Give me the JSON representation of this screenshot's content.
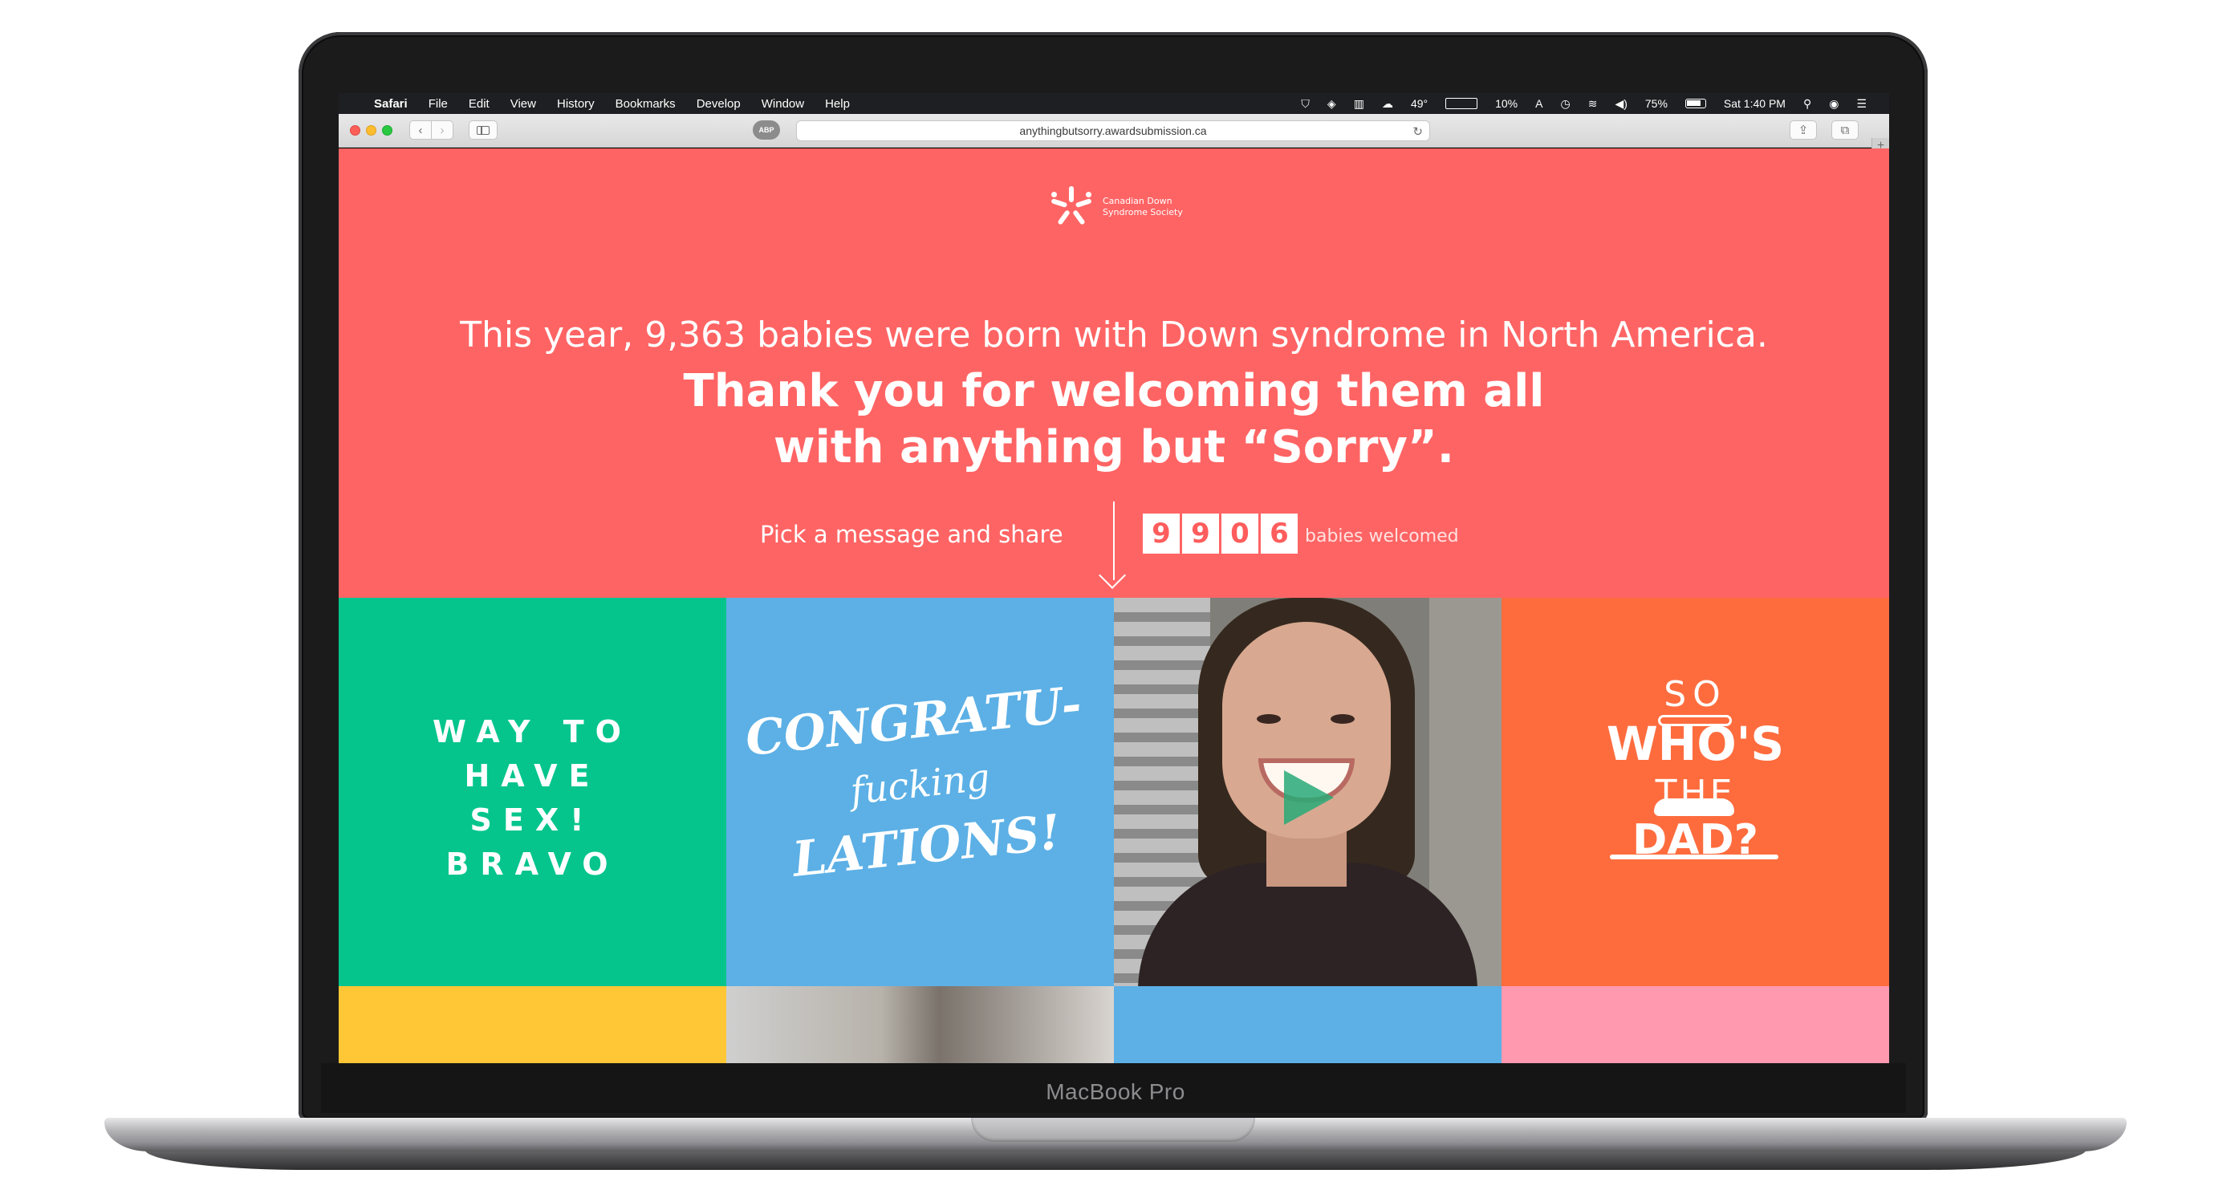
{
  "device": {
    "label": "MacBook Pro"
  },
  "menubar": {
    "app": "Safari",
    "items": [
      "File",
      "Edit",
      "View",
      "History",
      "Bookmarks",
      "Develop",
      "Window",
      "Help"
    ],
    "status": {
      "temperature": "49°",
      "percent_a": "10%",
      "letter": "A",
      "battery": "75%",
      "clock": "Sat 1:40 PM"
    }
  },
  "browser": {
    "url": "anythingbutsorry.awardsubmission.ca",
    "extension_badge": "ABP"
  },
  "page": {
    "logo_text": "Canadian Down Syndrome Society",
    "headline_1": "This year, 9,363 babies were born with Down syndrome in North America.",
    "headline_2": "Thank you for welcoming them all with anything but “Sorry”.",
    "pick_text": "Pick a message and share",
    "counter_digits": [
      "9",
      "9",
      "0",
      "6"
    ],
    "counter_label": "babies welcomed",
    "tiles": {
      "green_lines": [
        "WAY TO",
        "HAVE",
        "SEX!",
        "BRAVO"
      ],
      "congrats_lines": [
        "CONGRATU-",
        "fucking",
        "LATIONS!"
      ],
      "orange_lines": [
        "SO",
        "WHO'S",
        "THE",
        "DAD?"
      ]
    }
  },
  "colors": {
    "page_bg": "#ff6464",
    "green_tile": "#05c58d",
    "blue_tile": "#5cb0e5",
    "orange_tile": "#fe6c3e",
    "yellow_tile": "#ffc636",
    "pink_tile": "#ff99b0"
  }
}
